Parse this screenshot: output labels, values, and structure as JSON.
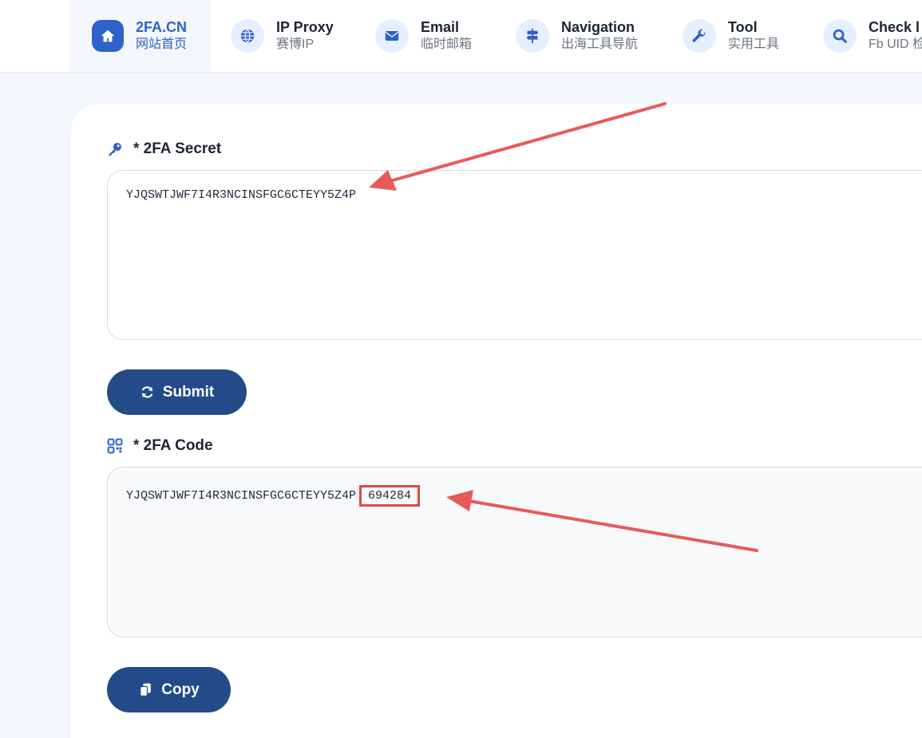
{
  "nav": {
    "items": [
      {
        "title": "2FA.CN",
        "sub": "网站首页",
        "icon": "home-icon"
      },
      {
        "title": "IP Proxy",
        "sub": "赛博IP",
        "icon": "globe-icon"
      },
      {
        "title": "Email",
        "sub": "临时邮箱",
        "icon": "envelope-icon"
      },
      {
        "title": "Navigation",
        "sub": "出海工具导航",
        "icon": "signpost-icon"
      },
      {
        "title": "Tool",
        "sub": "实用工具",
        "icon": "wrench-icon"
      },
      {
        "title": "Check l",
        "sub": "Fb UID 检",
        "icon": "search-icon"
      }
    ]
  },
  "secret": {
    "label": "* 2FA Secret",
    "value": "YJQSWTJWF7I4R3NCINSFGC6CTEYY5Z4P"
  },
  "submit": {
    "label": "Submit"
  },
  "code": {
    "label": "* 2FA Code",
    "secret_echo": "YJQSWTJWF7I4R3NCINSFGC6CTEYY5Z4P",
    "otp": "694284"
  },
  "copy": {
    "label": "Copy"
  },
  "colors": {
    "accent": "#2f62c9",
    "button": "#234b8a",
    "annotation": "#e04848"
  }
}
